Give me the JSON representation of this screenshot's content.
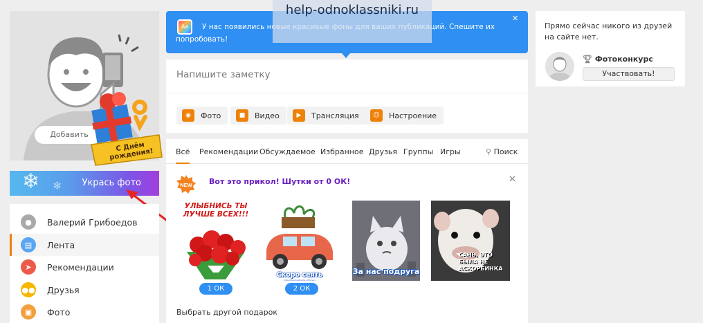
{
  "watermark": "help-odnoklassniki.ru",
  "profile": {
    "add_photo_label": "Добавить",
    "decorate_button": "Укрась фото",
    "birthday_text": "С Днём рождения!"
  },
  "menu": [
    {
      "label": "Валерий Грибоедов",
      "icon": "user-icon",
      "color": "#a9a9a9"
    },
    {
      "label": "Лента",
      "icon": "feed-icon",
      "color": "#5aa6f2",
      "active": true
    },
    {
      "label": "Рекомендации",
      "icon": "compass-icon",
      "color": "#ee5a4a"
    },
    {
      "label": "Друзья",
      "icon": "friends-icon",
      "color": "#f5b700"
    },
    {
      "label": "Фото",
      "icon": "photo-icon",
      "color": "#f2a03d"
    }
  ],
  "banner": {
    "text": "У нас появились новые красивые фоны для ваших публикаций. Спешите их попробовать!",
    "icon_text": "Aa",
    "close": "✕"
  },
  "note": {
    "placeholder": "Напишите заметку",
    "actions": [
      {
        "label": "Фото",
        "icon": "camera-icon"
      },
      {
        "label": "Видео",
        "icon": "video-icon"
      },
      {
        "label": "Трансляция",
        "icon": "broadcast-icon"
      },
      {
        "label": "Настроение",
        "icon": "mood-icon"
      }
    ]
  },
  "feed": {
    "tabs": [
      "Всё",
      "Рекомендации",
      "Обсуждаемое",
      "Избранное",
      "Друзья",
      "Группы",
      "Игры"
    ],
    "search_label": "Поиск",
    "promo_title": "Вот это прикол! Шутки от 0 ОК!",
    "new_badge": "NEW",
    "gifts": [
      {
        "caption": "УЛЫБНИСЬ ТЫ ЛУЧШЕ ВСЕХ!!!",
        "price": "1 ОК"
      },
      {
        "caption": "Скоро сеять рассаду",
        "price": "2 ОК"
      },
      {
        "caption": "За нас подруга",
        "price": ""
      },
      {
        "caption": "САНЬ, ЭТО БЫЛА НЕ АСКОРБИНКА",
        "price": ""
      }
    ],
    "other_gift": "Выбрать другой подарок"
  },
  "right": {
    "online_text": "Прямо сейчас никого из друзей на сайте нет.",
    "contest_title": "Фотоконкурс",
    "participate": "Участвовать!"
  }
}
